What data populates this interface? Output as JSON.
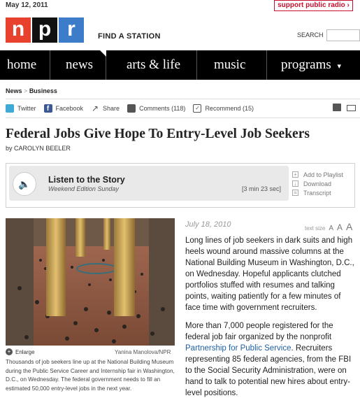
{
  "header": {
    "date": "May 12, 2011",
    "support_label": "support public radio ›",
    "logo_letters": [
      "n",
      "p",
      "r"
    ],
    "find_station": "FIND A STATION",
    "search_label": "SEARCH",
    "search_value": ""
  },
  "nav": {
    "items": [
      {
        "label": "home"
      },
      {
        "label": "news"
      },
      {
        "label": "arts & life"
      },
      {
        "label": "music"
      },
      {
        "label": "programs"
      }
    ],
    "caret": "▾"
  },
  "breadcrumb": {
    "section": "News",
    "separator": ">",
    "subsection": "Business"
  },
  "share": {
    "twitter": "Twitter",
    "facebook": "Facebook",
    "share": "Share",
    "comments": "Comments (118)",
    "recommend": "Recommend (15)"
  },
  "article": {
    "headline": "Federal Jobs Give Hope To Entry-Level Job Seekers",
    "byline_prefix": "by",
    "author": "CAROLYN BEELER",
    "date": "July 18, 2010",
    "text_size_label": "text size",
    "text_size_letters": [
      "A",
      "A",
      "A"
    ],
    "para1": "Long lines of job seekers in dark suits and high heels wound around massive columns at the National Building Museum in Washington, D.C., on Wednesday. Hopeful applicants clutched portfolios stuffed with resumes and talking points, waiting patiently for a few minutes of face time with government recruiters.",
    "para2_before": "More than 7,000 people registered for the federal job fair organized by the nonprofit ",
    "para2_link": "Partnership for Public Service",
    "para2_after": ". Recruiters representing 85 federal agencies, from the FBI to the Social Security Administration, were on hand to talk to potential new hires about entry-level positions."
  },
  "listen": {
    "title": "Listen to the Story",
    "program": "Weekend Edition Sunday",
    "duration": "[3 min 23 sec]",
    "actions": [
      "Add to Playlist",
      "Download",
      "Transcript"
    ]
  },
  "photo": {
    "enlarge": "Enlarge",
    "credit": "Yanina Manolova/NPR",
    "caption": "Thousands of job seekers line up at the National Building Museum during the Public Service Career and Internship fair in Washington, D.C., on Wednesday. The federal government needs to fill an estimated 50,000 entry-level jobs in the next year."
  }
}
